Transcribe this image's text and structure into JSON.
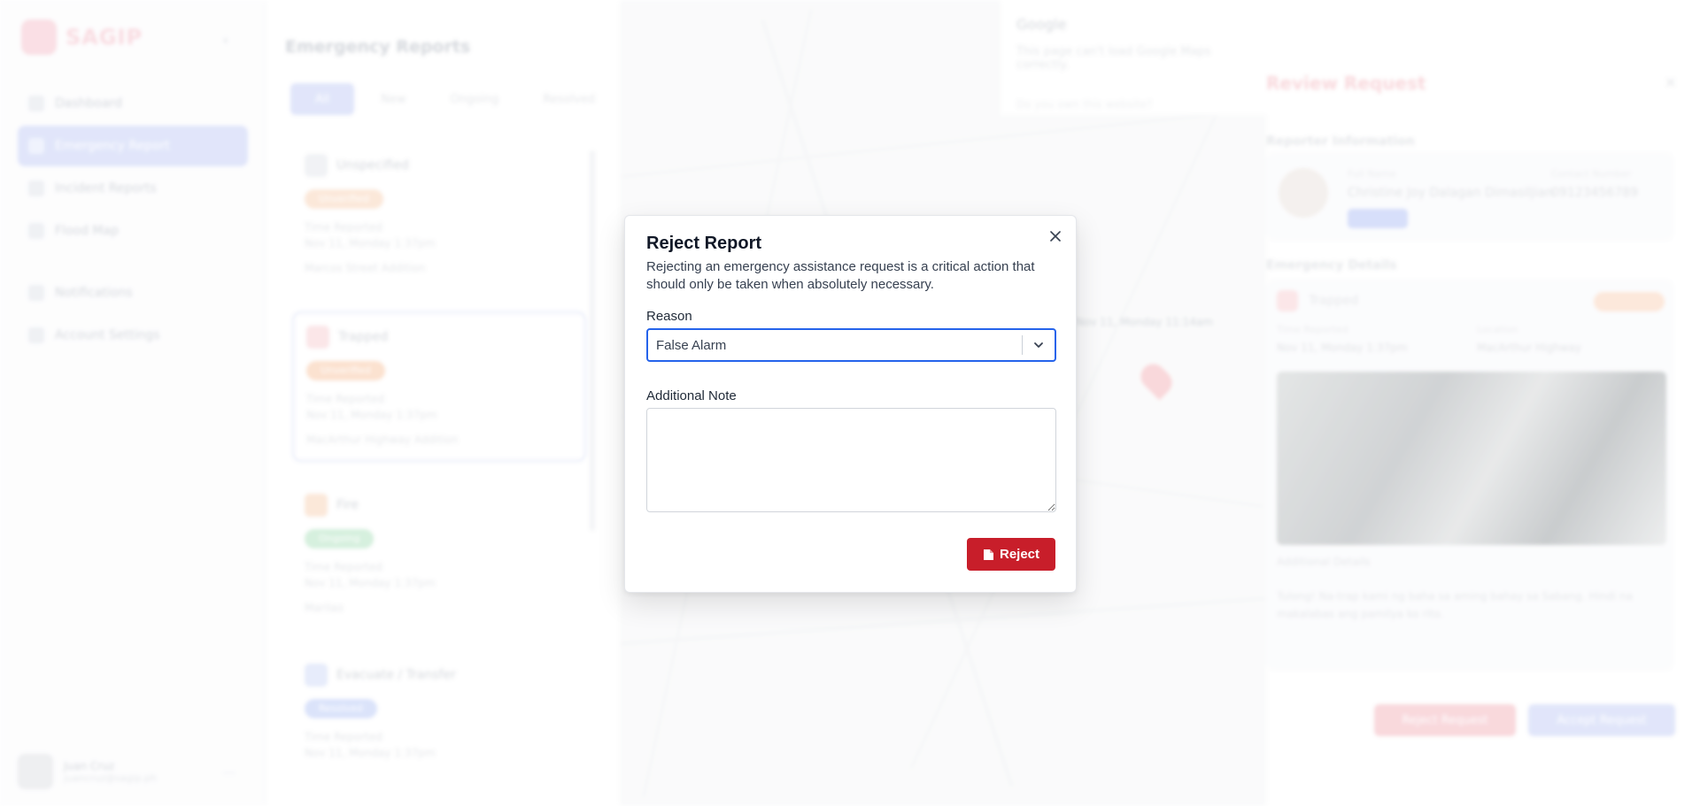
{
  "app": {
    "logo": "SAGIP",
    "nav": [
      "Dashboard",
      "Emergency Report",
      "Incident Reports",
      "Flood Map",
      "Notifications",
      "Account Settings"
    ],
    "user": {
      "name": "Juan Cruz",
      "email": "juancruz@sagip.ph"
    }
  },
  "reports": {
    "title": "Emergency Reports",
    "tabs": [
      "All",
      "New",
      "Ongoing",
      "Resolved"
    ],
    "cards": [
      {
        "type": "Unspecified",
        "badge": "Unverified",
        "badge_color": "#f7c9a6",
        "label": "Time Reported",
        "time": "Nov 11, Monday 1:37pm",
        "loc": "Marcos Street Addition"
      },
      {
        "type": "Trapped",
        "badge": "Unverified",
        "badge_color": "#f7b98e",
        "label": "Time Reported",
        "time": "Nov 11, Monday 1:37pm",
        "loc": "MacArthur Highway Addition"
      },
      {
        "type": "Fire",
        "badge": "Ongoing",
        "badge_color": "#9ddbb0",
        "label": "Time Reported",
        "time": "Nov 11, Monday 1:37pm",
        "loc": "Marilao"
      },
      {
        "type": "Evacuate / Transfer",
        "badge": "Resolved",
        "badge_color": "#a9bdf5",
        "label": "Time Reported",
        "time": "Nov 11, Monday 1:37pm",
        "loc": ""
      }
    ]
  },
  "map": {
    "google_title": "Google",
    "google_desc": "This page can't load Google Maps correctly.",
    "google_link": "Do you own this website?",
    "info": "Nov 11, Monday 11:14am"
  },
  "panel": {
    "title": "Review Request",
    "reporter_section": "Reporter Information",
    "fullname_label": "Full Name",
    "fullname": "Christine Joy Dalagan Dimasiljian",
    "contact_label": "Contact Number",
    "contact": "09123456789",
    "emergency_section": "Emergency Details",
    "em_type": "Trapped",
    "time_label": "Time Reported",
    "time": "Nov 11, Monday 1:37pm",
    "location_label": "Location",
    "location": "MacArthur Highway",
    "note_label": "Additional Details",
    "note": "Tulong! Na-trap kami ng baha sa aming bahay sa Sabang. Hindi na makalabas ang pamilya ko rito.",
    "reject_btn": "Reject Request",
    "accept_btn": "Accept Request"
  },
  "modal": {
    "title": "Reject Report",
    "description": "Rejecting an emergency assistance request is a critical action that should only be taken when absolutely necessary.",
    "reason_label": "Reason",
    "reason_value": "False Alarm",
    "note_label": "Additional Note",
    "note_placeholder": "",
    "reject_label": "Reject",
    "accent": "#2563eb",
    "danger": "#c81e2a"
  }
}
